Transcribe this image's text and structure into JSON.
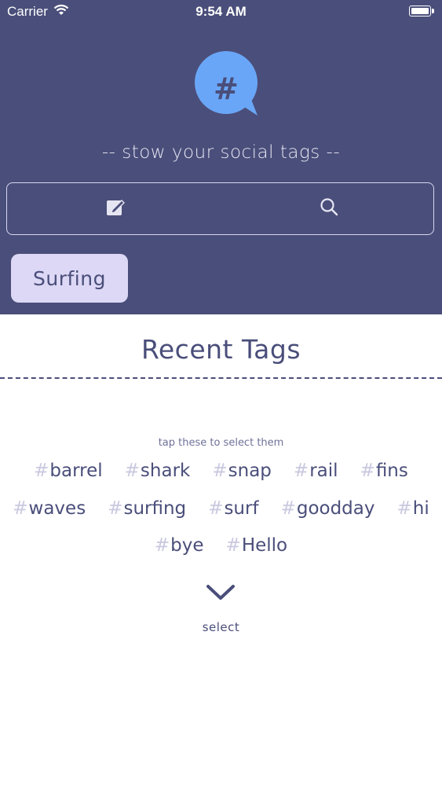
{
  "status_bar": {
    "carrier": "Carrier",
    "time": "9:54 AM"
  },
  "app": {
    "logo_glyph": "#",
    "tagline": "-- stow your social tags --"
  },
  "toolbar": {
    "compose_icon": "compose-icon",
    "search_icon": "search-icon"
  },
  "current_tag": "Surfing",
  "recent": {
    "title": "Recent Tags",
    "hint": "tap these to select them",
    "hash_symbol": "#",
    "rows": [
      [
        "barrel",
        "shark",
        "snap",
        "rail",
        "fins"
      ],
      [
        "waves",
        "surfing",
        "surf",
        "goodday",
        "hi"
      ],
      [
        "bye",
        "Hello"
      ]
    ],
    "select_label": "select"
  },
  "colors": {
    "header_bg": "#4a4e7a",
    "accent": "#6aa6f7",
    "chip_bg": "#dcd8f5",
    "text": "#4a4e7a"
  }
}
